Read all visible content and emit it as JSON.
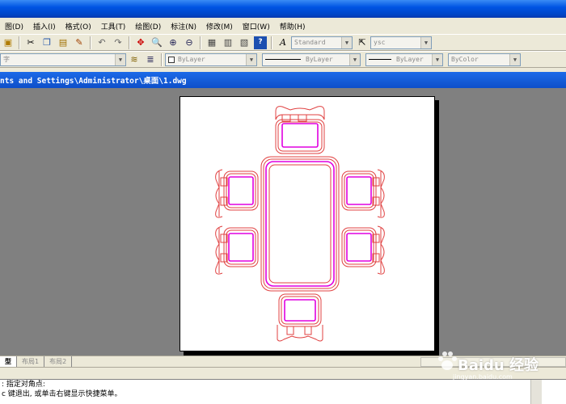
{
  "menu": {
    "items": [
      "图(D)",
      "插入(I)",
      "格式(O)",
      "工具(T)",
      "绘图(D)",
      "标注(N)",
      "修改(M)",
      "窗口(W)",
      "帮助(H)"
    ]
  },
  "toolbar1": {
    "text_style": "Standard",
    "dim_style": "ysc"
  },
  "toolbar2": {
    "layer": "字",
    "color": "ByLayer",
    "linetype": "ByLayer",
    "lineweight": "ByLayer",
    "plotstyle": "ByColor"
  },
  "drawing": {
    "path": "nts and Settings\\Administrator\\桌面\\1.dwg"
  },
  "tabs": [
    "型",
    "布局1",
    "布局2"
  ],
  "command": {
    "line1": ": 指定对角点:",
    "line2": "c 键退出, 或单击右键显示快捷菜单。"
  },
  "watermark": {
    "brand": "Baidu 经验",
    "url": "jingyan.baidu.com"
  },
  "colors": {
    "furniture_outline": "#e04040",
    "furniture_inner": "#e000e0",
    "title_blue": "#0e4fc9"
  }
}
